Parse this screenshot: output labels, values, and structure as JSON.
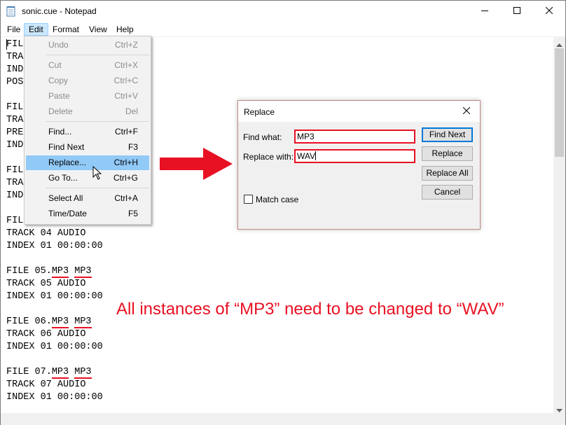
{
  "window": {
    "title": "sonic.cue - Notepad",
    "controls": [
      "minimize",
      "maximize",
      "close"
    ]
  },
  "menubar": {
    "items": [
      {
        "label": "File"
      },
      {
        "label": "Edit",
        "active": true
      },
      {
        "label": "Format"
      },
      {
        "label": "View"
      },
      {
        "label": "Help"
      }
    ]
  },
  "editor": {
    "lines": [
      "FILE",
      "TRAC",
      "INDE",
      "POST",
      "",
      "FILE",
      "TRAC",
      "PREG",
      "INDE",
      "",
      "FILE",
      "TRAC",
      "INDE",
      "",
      "FILE 04.MP3 MP3",
      "TRACK 04 AUDIO",
      "INDEX 01 00:00:00",
      "",
      "FILE 05.MP3 MP3",
      "TRACK 05 AUDIO",
      "INDEX 01 00:00:00",
      "",
      "FILE 06.MP3 MP3",
      "TRACK 06 AUDIO",
      "INDEX 01 00:00:00",
      "",
      "FILE 07.MP3 MP3",
      "TRACK 07 AUDIO",
      "INDEX 01 00:00:00"
    ],
    "file_parts": [
      {
        "prefix": "FILE 05.",
        "ext": "MP3",
        "fmt": "MP3"
      },
      {
        "prefix": "FILE 06.",
        "ext": "MP3",
        "fmt": "MP3"
      },
      {
        "prefix": "FILE 07.",
        "ext": "MP3",
        "fmt": "MP3"
      }
    ]
  },
  "edit_menu": {
    "items": [
      {
        "label": "Undo",
        "shortcut": "Ctrl+Z",
        "disabled": true
      },
      {
        "label": "Cut",
        "shortcut": "Ctrl+X",
        "disabled": true
      },
      {
        "label": "Copy",
        "shortcut": "Ctrl+C",
        "disabled": true
      },
      {
        "label": "Paste",
        "shortcut": "Ctrl+V",
        "disabled": true
      },
      {
        "label": "Delete",
        "shortcut": "Del",
        "disabled": true
      },
      {
        "label": "Find...",
        "shortcut": "Ctrl+F"
      },
      {
        "label": "Find Next",
        "shortcut": "F3"
      },
      {
        "label": "Replace...",
        "shortcut": "Ctrl+H",
        "highlighted": true
      },
      {
        "label": "Go To...",
        "shortcut": "Ctrl+G"
      },
      {
        "label": "Select All",
        "shortcut": "Ctrl+A"
      },
      {
        "label": "Time/Date",
        "shortcut": "F5"
      }
    ]
  },
  "replace_dialog": {
    "title": "Replace",
    "find_label": "Find what:",
    "find_value": "MP3",
    "replace_label": "Replace with:",
    "replace_value": "WAV",
    "buttons": {
      "find_next": "Find Next",
      "replace": "Replace",
      "replace_all": "Replace All",
      "cancel": "Cancel"
    },
    "match_case_label": "Match case",
    "match_case_checked": false
  },
  "annotation": {
    "text": "All instances of “MP3” need to be changed to “WAV”",
    "color": "#e81123"
  },
  "colors": {
    "highlight_red": "#e81123",
    "menu_active": "#cce8ff",
    "menu_hover": "#91c9f7",
    "dialog_default_button": "#0078d7"
  }
}
